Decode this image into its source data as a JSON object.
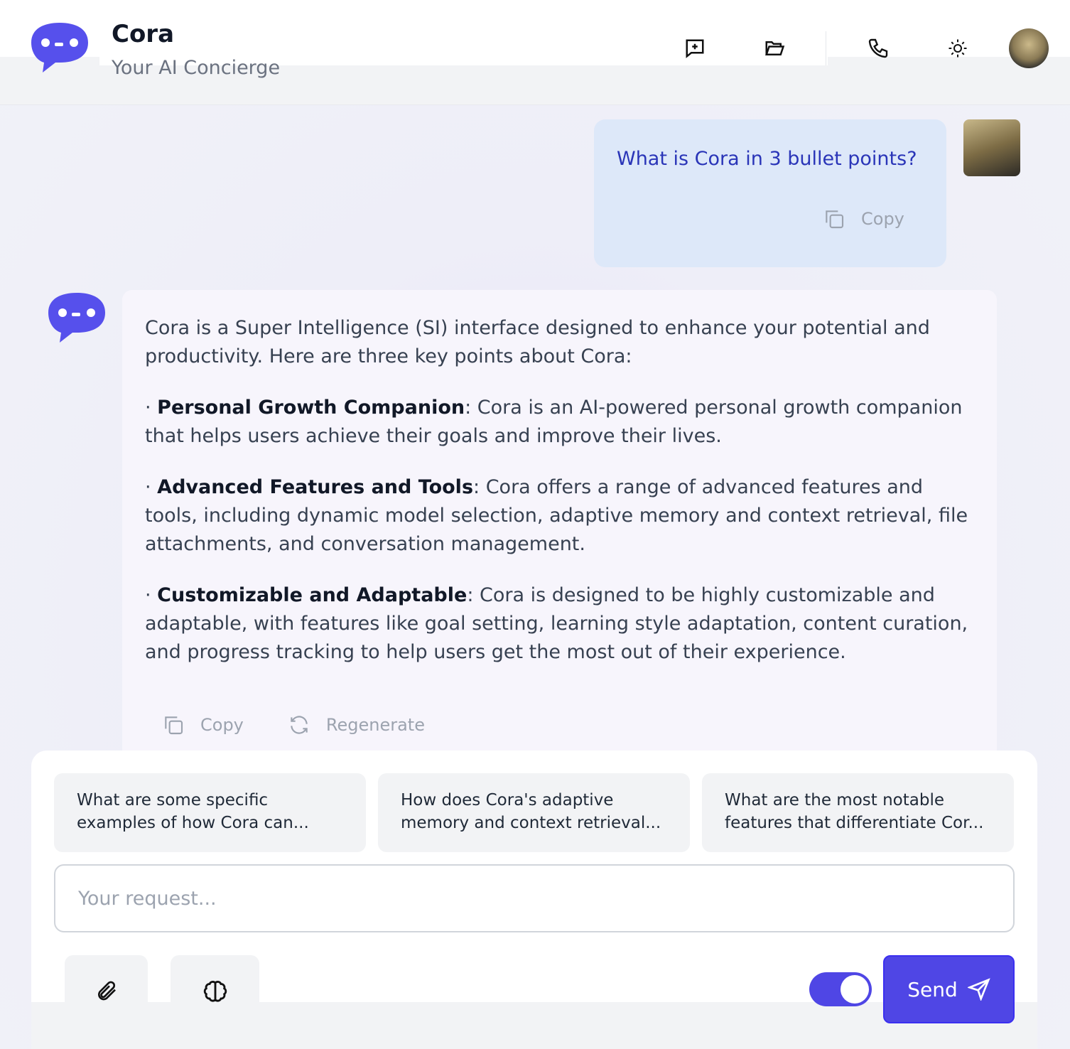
{
  "header": {
    "title": "Cora",
    "subtitle": "Your AI Concierge"
  },
  "colors": {
    "accent": "#4f46e5",
    "user_bubble": "#dde8f9",
    "assistant_bubble": "#f7f5fc"
  },
  "user_message": {
    "text": "What is Cora in 3 bullet points?",
    "copy_label": "Copy"
  },
  "assistant_message": {
    "intro": "Cora is a Super Intelligence (SI) interface designed to enhance your potential and productivity. Here are three key points about Cora:",
    "bullets": [
      {
        "title": "Personal Growth Companion",
        "text": ": Cora is an AI-powered personal growth companion that helps users achieve their goals and improve their lives."
      },
      {
        "title": "Advanced Features and Tools",
        "text": ": Cora offers a range of advanced features and tools, including dynamic model selection, adaptive memory and context retrieval, file attachments, and conversation management."
      },
      {
        "title": "Customizable and Adaptable",
        "text": ": Cora is designed to be highly customizable and adaptable, with features like goal setting, learning style adaptation, content curation, and progress tracking to help users get the most out of their experience."
      }
    ],
    "copy_label": "Copy",
    "regenerate_label": "Regenerate"
  },
  "suggestions": [
    "What are some specific examples of how Cora can...",
    "How does Cora's adaptive memory and context retrieval...",
    "What are the most notable features that differentiate Cor..."
  ],
  "composer": {
    "placeholder": "Your request...",
    "send_label": "Send",
    "toggle_on": true
  }
}
